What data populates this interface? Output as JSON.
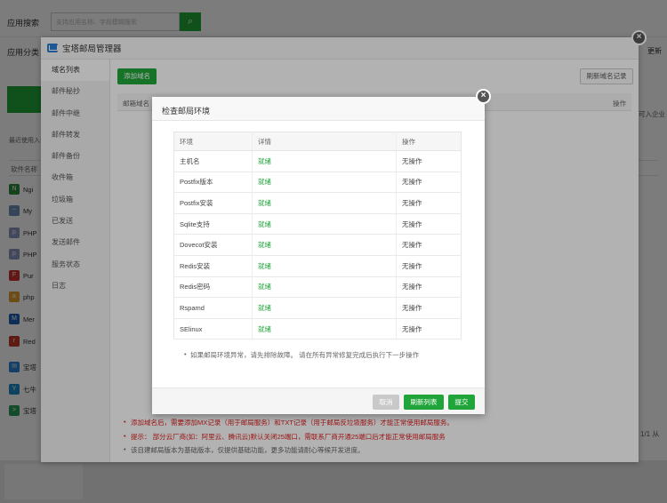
{
  "background": {
    "search_label": "应用搜索",
    "search_placeholder": "支持应用名称、字段模糊搜索",
    "category_label": "应用分类",
    "more_label": "更新",
    "recent_label": "最近使用入口",
    "soft_header": "软件名称",
    "right_text": "可入企业",
    "page_text": "1/1   从",
    "softwares": [
      {
        "icon": "nginx-icon",
        "name": "Ngi",
        "color": "#2e8b3e",
        "glyph": "N"
      },
      {
        "icon": "mysql-icon",
        "name": "My",
        "color": "#6a8fb0",
        "glyph": "~"
      },
      {
        "icon": "php-icon",
        "name": "PHP",
        "color": "#8892bf",
        "glyph": "p"
      },
      {
        "icon": "php-icon",
        "name": "PHP",
        "color": "#8892bf",
        "glyph": "p"
      },
      {
        "icon": "pure-ftpd-icon",
        "name": "Pur",
        "color": "#c33",
        "glyph": "F"
      },
      {
        "icon": "phpmyadmin-icon",
        "name": "php",
        "color": "#e0a030",
        "glyph": "a"
      },
      {
        "icon": "memcached-icon",
        "name": "Mer",
        "color": "#2060b0",
        "glyph": "M"
      },
      {
        "icon": "redis-icon",
        "name": "Red",
        "color": "#c0392b",
        "glyph": "r"
      },
      {
        "icon": "mail-icon",
        "name": "宝塔",
        "color": "#2a7fd4",
        "glyph": "✉"
      },
      {
        "icon": "qiniu-icon",
        "name": "七牛",
        "color": "#1e88c8",
        "glyph": "Y"
      },
      {
        "icon": "terminal-icon",
        "name": "宝塔",
        "color": "#2a9d5a",
        "glyph": ">"
      }
    ]
  },
  "mail_manager": {
    "title": "宝塔邮局管理器",
    "close_label": "×",
    "sidebar": [
      {
        "label": "域名列表",
        "active": true
      },
      {
        "label": "邮件秘抄",
        "active": false
      },
      {
        "label": "邮件中继",
        "active": false
      },
      {
        "label": "邮件转发",
        "active": false
      },
      {
        "label": "邮件备份",
        "active": false
      },
      {
        "label": "收件箱",
        "active": false
      },
      {
        "label": "垃圾箱",
        "active": false
      },
      {
        "label": "已发送",
        "active": false
      },
      {
        "label": "发送邮件",
        "active": false
      },
      {
        "label": "服务状态",
        "active": false
      },
      {
        "label": "日志",
        "active": false
      }
    ],
    "add_domain_button": "添加域名",
    "refresh_domain_button": "刷新域名记录",
    "table_header": {
      "domain": "邮箱域名",
      "action": "操作"
    },
    "tips": [
      "添加域名后，需要添加MX记录（用于邮局服务）和TXT记录（用于邮局反垃圾服务）才能正常使用邮局服务。",
      "提示： 部分云厂商(如：阿里云、腾讯云)默认关闭25端口，需联系厂商开通25端口后才能正常使用邮局服务",
      "该自建邮局版本为基础版本，仅提供基础功能，更多功能请耐心等候开发进度。"
    ]
  },
  "env_dialog": {
    "title": "检查邮局环境",
    "close_label": "×",
    "columns": [
      "环境",
      "详情",
      "操作"
    ],
    "rows": [
      {
        "env": "主机名",
        "detail": "就绪",
        "action": "无操作"
      },
      {
        "env": "Postfix版本",
        "detail": "就绪",
        "action": "无操作"
      },
      {
        "env": "Postfix安装",
        "detail": "就绪",
        "action": "无操作"
      },
      {
        "env": "Sqlite支持",
        "detail": "就绪",
        "action": "无操作"
      },
      {
        "env": "Dovecot安装",
        "detail": "就绪",
        "action": "无操作"
      },
      {
        "env": "Redis安装",
        "detail": "就绪",
        "action": "无操作"
      },
      {
        "env": "Redis密码",
        "detail": "就绪",
        "action": "无操作"
      },
      {
        "env": "Rspamd",
        "detail": "就绪",
        "action": "无操作"
      },
      {
        "env": "SElinux",
        "detail": "就绪",
        "action": "无操作"
      }
    ],
    "note": "如果邮局环境异常，请先排除故障。 请在所有异常修复完成后执行下一步操作",
    "buttons": {
      "cancel": "取消",
      "refresh": "刷新列表",
      "submit": "提交"
    },
    "status_color": "#20a53a"
  }
}
